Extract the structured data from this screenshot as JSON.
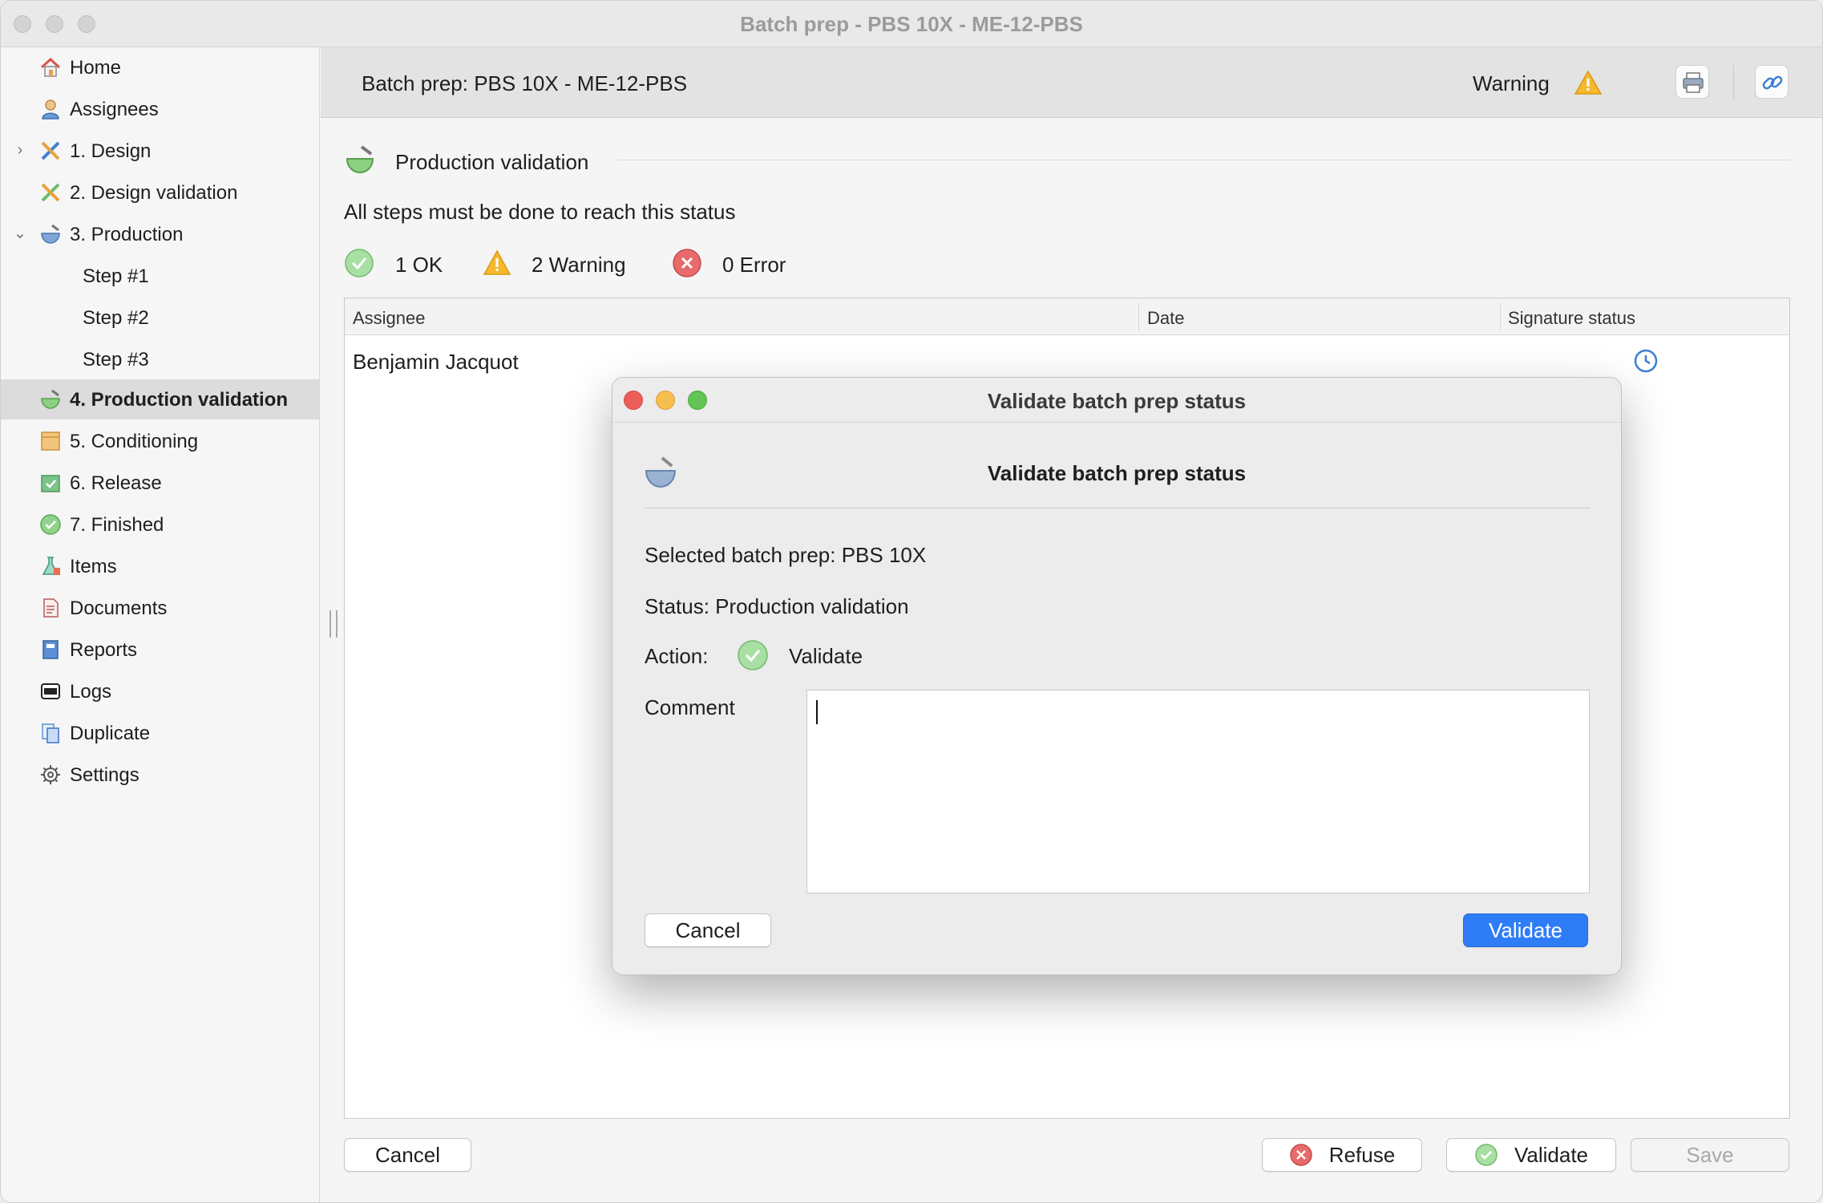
{
  "window": {
    "title": "Batch prep - PBS 10X - ME-12-PBS"
  },
  "sidebar": {
    "items": [
      {
        "label": "Home",
        "icon": "home-icon"
      },
      {
        "label": "Assignees",
        "icon": "person-icon"
      },
      {
        "label": "1. Design",
        "icon": "design-tools-icon",
        "expander": "collapsed"
      },
      {
        "label": "2. Design validation",
        "icon": "design-tools-icon"
      },
      {
        "label": "3. Production",
        "icon": "mortar-pestle-icon",
        "expander": "expanded"
      },
      {
        "label": "Step #1",
        "icon": ""
      },
      {
        "label": "Step #2",
        "icon": ""
      },
      {
        "label": "Step #3",
        "icon": ""
      },
      {
        "label": "4. Production validation",
        "icon": "mortar-pestle-green-icon",
        "selected": true
      },
      {
        "label": "5. Conditioning",
        "icon": "box-icon"
      },
      {
        "label": "6. Release",
        "icon": "release-box-icon"
      },
      {
        "label": "7. Finished",
        "icon": "check-circle-icon"
      },
      {
        "label": "Items",
        "icon": "flask-icon"
      },
      {
        "label": "Documents",
        "icon": "document-icon"
      },
      {
        "label": "Reports",
        "icon": "report-book-icon"
      },
      {
        "label": "Logs",
        "icon": "log-icon"
      },
      {
        "label": "Duplicate",
        "icon": "duplicate-icon"
      },
      {
        "label": "Settings",
        "icon": "gear-icon"
      }
    ]
  },
  "header": {
    "title": "Batch prep: PBS 10X - ME-12-PBS",
    "status": "Warning",
    "status_icon": "warning-icon",
    "print_icon": "printer-icon",
    "link_icon": "link-icon"
  },
  "section": {
    "title": "Production validation",
    "description": "All steps must be done to reach this status",
    "summary": [
      {
        "label": "1 OK",
        "icon": "ok-icon"
      },
      {
        "label": "2 Warning",
        "icon": "warning-icon"
      },
      {
        "label": "0 Error",
        "icon": "error-icon"
      }
    ]
  },
  "table": {
    "columns": [
      "Assignee",
      "Date",
      "Signature status"
    ],
    "rows": [
      {
        "assignee": "Benjamin Jacquot",
        "date": "",
        "signature_icon": "clock-icon"
      }
    ]
  },
  "footer": {
    "cancel": "Cancel",
    "refuse": "Refuse",
    "validate": "Validate",
    "save": "Save"
  },
  "dialog": {
    "title": "Validate batch prep status",
    "heading": "Validate batch prep status",
    "selected": "Selected batch prep: PBS 10X",
    "status": "Status: Production validation",
    "action_label": "Action:",
    "action_value": "Validate",
    "comment_label": "Comment",
    "comment_value": "",
    "cancel": "Cancel",
    "validate": "Validate"
  },
  "colors": {
    "accent": "#2f7df6",
    "ok": "#7fcf7a",
    "warning": "#f5b82e",
    "error": "#e35a5a",
    "selected_row": "#dcdcdc"
  }
}
